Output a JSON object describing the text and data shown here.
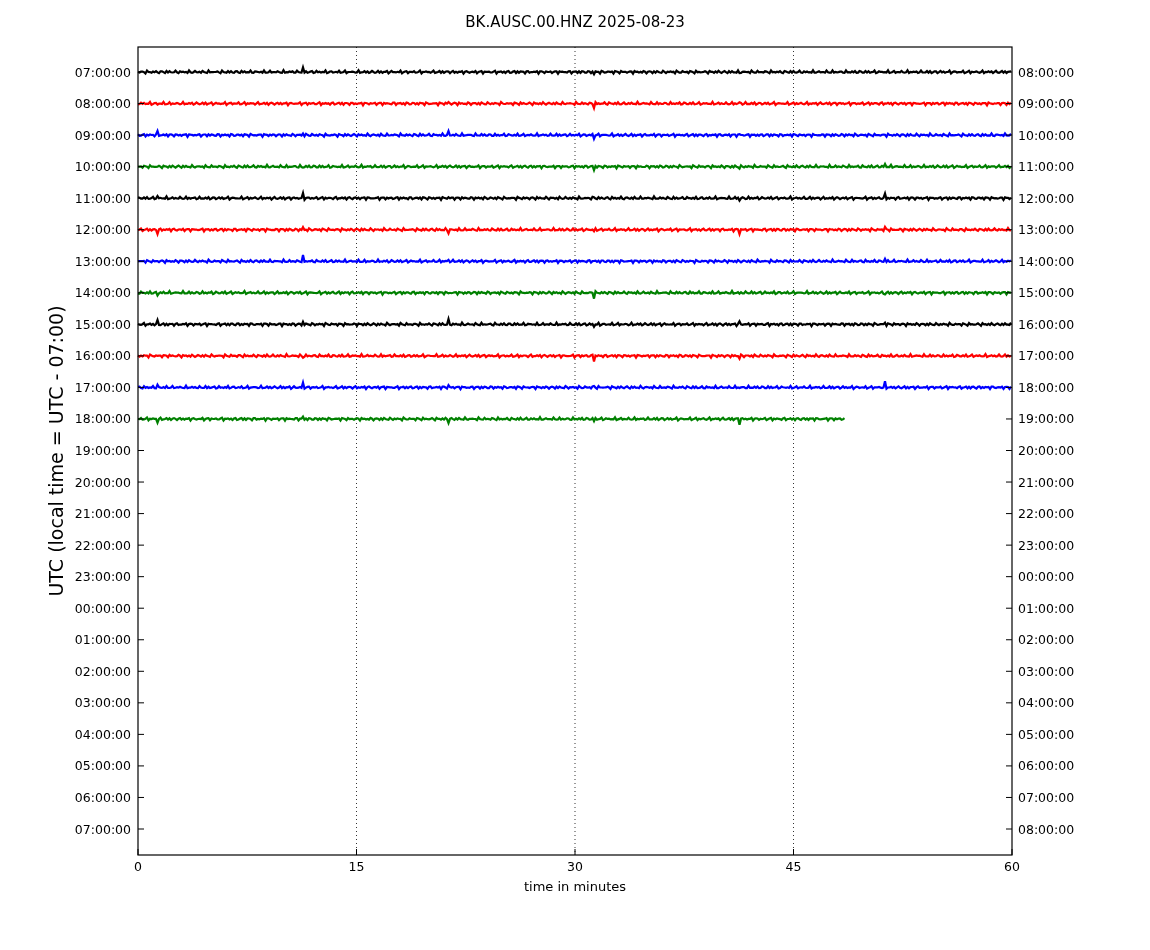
{
  "title": "BK.AUSC.00.HNZ 2025-08-23",
  "ylabel": "UTC (local time = UTC - 07:00)",
  "xlabel": "time in minutes",
  "xticks": [
    "0",
    "15",
    "30",
    "45",
    "60"
  ],
  "rows": [
    {
      "left": "07:00:00",
      "right": "08:00:00"
    },
    {
      "left": "08:00:00",
      "right": "09:00:00"
    },
    {
      "left": "09:00:00",
      "right": "10:00:00"
    },
    {
      "left": "10:00:00",
      "right": "11:00:00"
    },
    {
      "left": "11:00:00",
      "right": "12:00:00"
    },
    {
      "left": "12:00:00",
      "right": "13:00:00"
    },
    {
      "left": "13:00:00",
      "right": "14:00:00"
    },
    {
      "left": "14:00:00",
      "right": "15:00:00"
    },
    {
      "left": "15:00:00",
      "right": "16:00:00"
    },
    {
      "left": "16:00:00",
      "right": "17:00:00"
    },
    {
      "left": "17:00:00",
      "right": "18:00:00"
    },
    {
      "left": "18:00:00",
      "right": "19:00:00"
    },
    {
      "left": "19:00:00",
      "right": "20:00:00"
    },
    {
      "left": "20:00:00",
      "right": "21:00:00"
    },
    {
      "left": "21:00:00",
      "right": "22:00:00"
    },
    {
      "left": "22:00:00",
      "right": "23:00:00"
    },
    {
      "left": "23:00:00",
      "right": "00:00:00"
    },
    {
      "left": "00:00:00",
      "right": "01:00:00"
    },
    {
      "left": "01:00:00",
      "right": "02:00:00"
    },
    {
      "left": "02:00:00",
      "right": "03:00:00"
    },
    {
      "left": "03:00:00",
      "right": "04:00:00"
    },
    {
      "left": "04:00:00",
      "right": "05:00:00"
    },
    {
      "left": "05:00:00",
      "right": "06:00:00"
    },
    {
      "left": "06:00:00",
      "right": "07:00:00"
    },
    {
      "left": "07:00:00",
      "right": "08:00:00"
    }
  ],
  "traces": [
    {
      "color": "#000000",
      "level": 1
    },
    {
      "color": "#ff0000",
      "level": 1
    },
    {
      "color": "#0000ff",
      "level": 1
    },
    {
      "color": "#008000",
      "level": 1
    },
    {
      "color": "#000000",
      "level": 1
    },
    {
      "color": "#ff0000",
      "level": 1
    },
    {
      "color": "#0000ff",
      "level": 1
    },
    {
      "color": "#008000",
      "level": 1
    },
    {
      "color": "#000000",
      "level": 1
    },
    {
      "color": "#ff0000",
      "level": 1
    },
    {
      "color": "#0000ff",
      "level": 1
    },
    {
      "color": "#008000",
      "level": 0.81
    }
  ]
}
